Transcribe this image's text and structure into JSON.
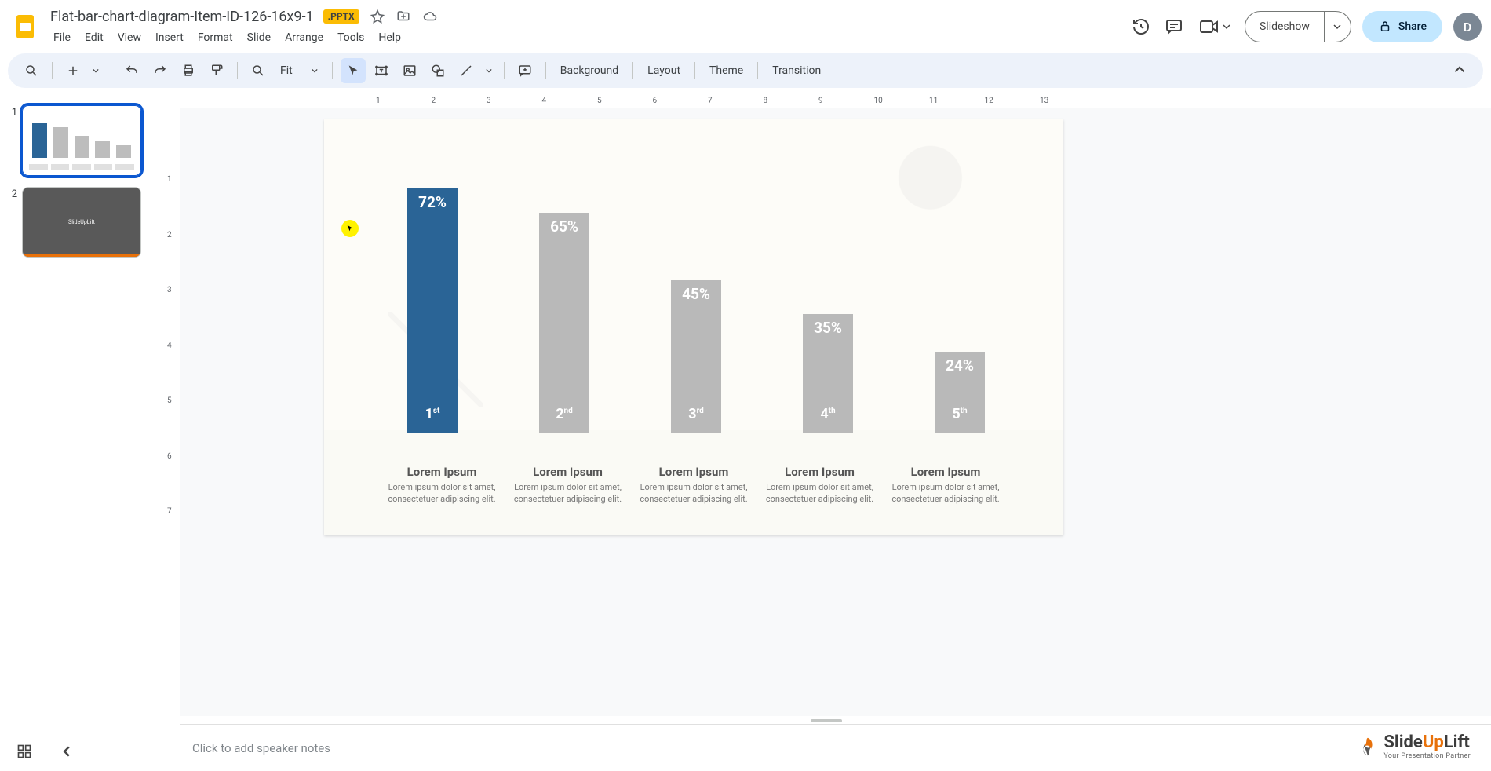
{
  "doc": {
    "title": "Flat-bar-chart-diagram-Item-ID-126-16x9-1",
    "badge": ".PPTX"
  },
  "menu": {
    "file": "File",
    "edit": "Edit",
    "view": "View",
    "insert": "Insert",
    "format": "Format",
    "slide": "Slide",
    "arrange": "Arrange",
    "tools": "Tools",
    "help": "Help"
  },
  "header_buttons": {
    "slideshow": "Slideshow",
    "share": "Share",
    "avatar": "D"
  },
  "toolbar": {
    "zoom": "Fit",
    "background": "Background",
    "layout": "Layout",
    "theme": "Theme",
    "transition": "Transition"
  },
  "ruler_h": [
    "1",
    "2",
    "3",
    "4",
    "5",
    "6",
    "7",
    "8",
    "9",
    "10",
    "11",
    "12",
    "13"
  ],
  "ruler_v": [
    "1",
    "2",
    "3",
    "4",
    "5",
    "6",
    "7"
  ],
  "thumbs": [
    {
      "num": "1"
    },
    {
      "num": "2",
      "label": "SlideUpLift"
    }
  ],
  "notes_placeholder": "Click to add speaker notes",
  "watermark": {
    "brand_a": "Slide",
    "brand_b": "Up",
    "brand_c": "Lift",
    "tag": "Your Presentation Partner"
  },
  "chart_data": {
    "type": "bar",
    "categories": [
      "1st",
      "2nd",
      "3rd",
      "4th",
      "5th"
    ],
    "values": [
      72,
      65,
      45,
      35,
      24
    ],
    "value_labels": [
      "72%",
      "65%",
      "45%",
      "35%",
      "24%"
    ],
    "ordinal_sup": [
      "st",
      "nd",
      "rd",
      "th",
      "th"
    ],
    "ordinal_num": [
      "1",
      "2",
      "3",
      "4",
      "5"
    ],
    "colors": [
      "#2a6496",
      "#b9b9b9",
      "#b9b9b9",
      "#b9b9b9",
      "#b9b9b9"
    ],
    "title": "",
    "ylim": [
      0,
      100
    ],
    "labels": [
      {
        "title": "Lorem Ipsum",
        "desc": "Lorem ipsum dolor sit amet, consectetuer adipiscing elit."
      },
      {
        "title": "Lorem Ipsum",
        "desc": "Lorem ipsum dolor sit amet, consectetuer adipiscing elit."
      },
      {
        "title": "Lorem Ipsum",
        "desc": "Lorem ipsum dolor sit amet, consectetuer adipiscing elit."
      },
      {
        "title": "Lorem Ipsum",
        "desc": "Lorem ipsum dolor sit amet, consectetuer adipiscing elit."
      },
      {
        "title": "Lorem Ipsum",
        "desc": "Lorem ipsum dolor sit amet, consectetuer adipiscing elit."
      }
    ]
  }
}
